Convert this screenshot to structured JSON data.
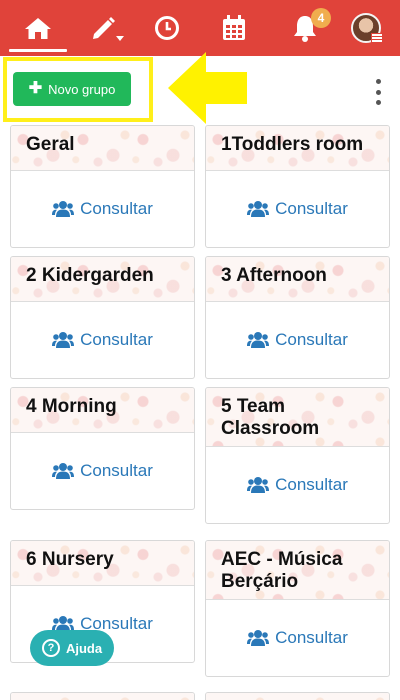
{
  "nav": {
    "notification_count": "4",
    "items": [
      {
        "name": "home",
        "icon": "home-icon"
      },
      {
        "name": "edit",
        "icon": "pencil-dropdown-icon"
      },
      {
        "name": "history",
        "icon": "clock-icon"
      },
      {
        "name": "calendar",
        "icon": "calendar-icon"
      },
      {
        "name": "notifications",
        "icon": "bell-icon"
      },
      {
        "name": "profile",
        "icon": "avatar-menu-icon"
      }
    ],
    "colors": {
      "bar": "#e0433a",
      "badge": "#f0ad4e"
    }
  },
  "toolbar": {
    "new_group_label": "Novo grupo",
    "new_group_icon": "plus-icon",
    "more_icon": "kebab-menu-icon",
    "highlight_color": "#ffef1a"
  },
  "groups": [
    {
      "title": "Geral",
      "action": "Consultar"
    },
    {
      "title": "1Toddlers room",
      "action": "Consultar"
    },
    {
      "title": "2 Kidergarden",
      "action": "Consultar"
    },
    {
      "title": "3 Afternoon",
      "action": "Consultar"
    },
    {
      "title": "4 Morning",
      "action": "Consultar"
    },
    {
      "title": "5 Team Classroom",
      "action": "Consultar"
    },
    {
      "title": "6 Nursery",
      "action": "Consultar"
    },
    {
      "title": "AEC - Música Berçário",
      "action": "Consultar"
    }
  ],
  "help": {
    "label": "Ajuda",
    "icon": "question-icon"
  },
  "colors": {
    "action_text": "#2a78b8",
    "new_group_button": "#21b85a",
    "help_button": "#2ab0b2"
  }
}
